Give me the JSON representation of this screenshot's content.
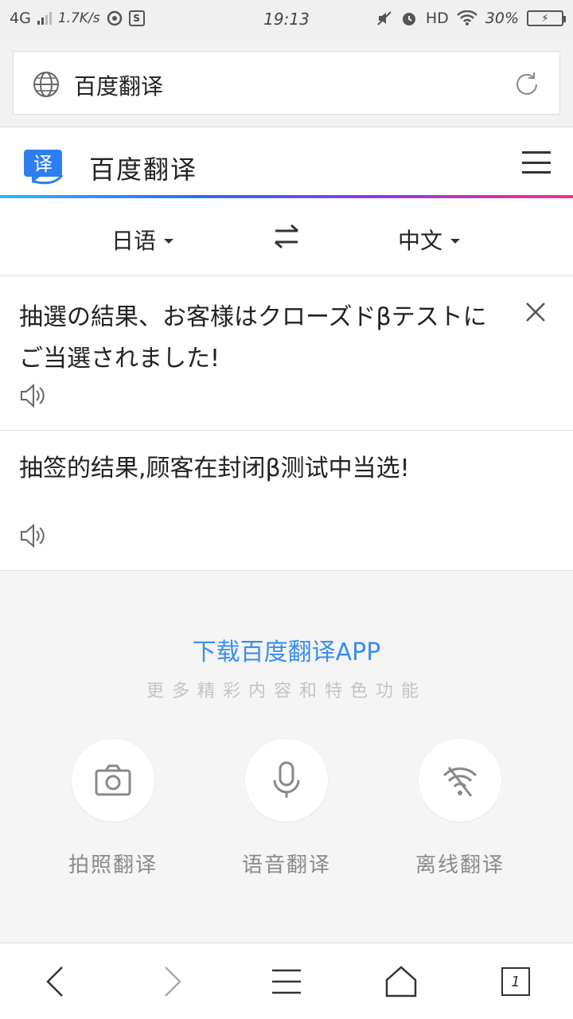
{
  "status_bar": {
    "network": "4G",
    "speed": "1.7K/s",
    "time": "19:13",
    "hd": "HD",
    "battery": "30%"
  },
  "browser": {
    "url_text": "百度翻译"
  },
  "app": {
    "logo_char": "译",
    "title": "百度翻译"
  },
  "languages": {
    "source": "日语",
    "target": "中文"
  },
  "source_text": "抽選の結果、お客様はクローズドβテストにご当選されました!",
  "result_text": "抽签的结果,顾客在封闭β测试中当选!",
  "promo": {
    "title": "下载百度翻译APP",
    "subtitle": "更多精彩内容和特色功能"
  },
  "features": [
    {
      "label": "拍照翻译",
      "icon": "camera-icon"
    },
    {
      "label": "语音翻译",
      "icon": "microphone-icon"
    },
    {
      "label": "离线翻译",
      "icon": "wifi-off-icon"
    }
  ],
  "bottom_nav": {
    "tab_count": "1"
  },
  "colors": {
    "accent": "#3b8df0",
    "logo_blue": "#2d7ff0",
    "gradient_start": "#2fb5ff",
    "gradient_end": "#ff2a82"
  }
}
